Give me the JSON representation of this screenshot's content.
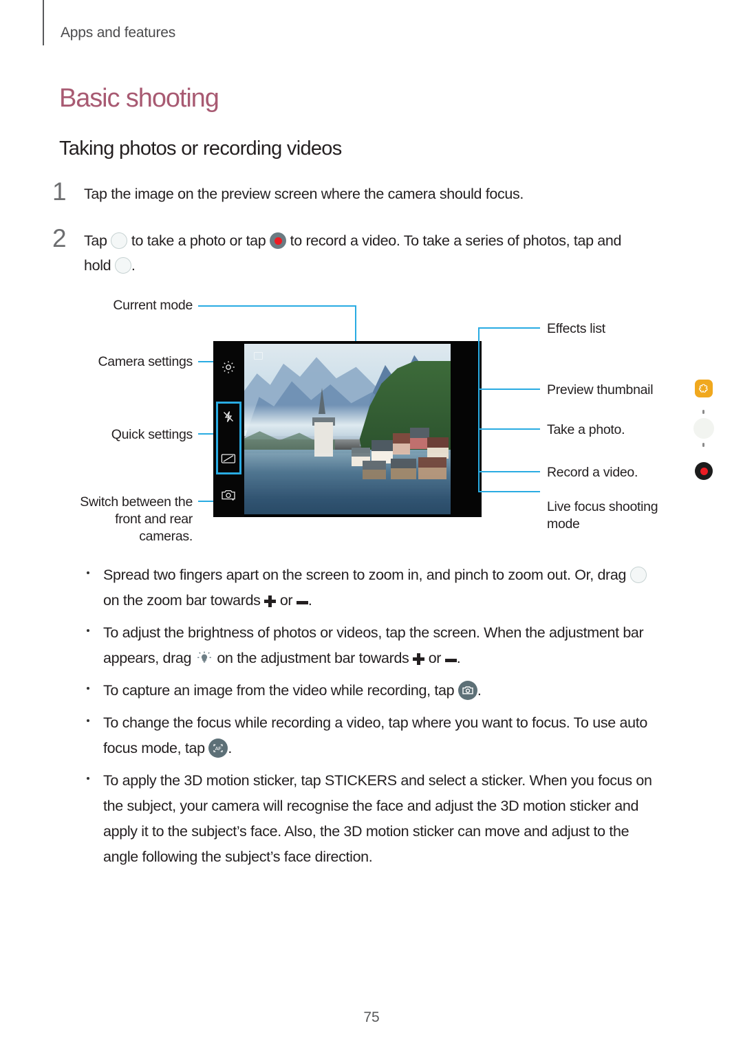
{
  "header": {
    "running_head": "Apps and features"
  },
  "chapter_title": "Basic shooting",
  "section_title": "Taking photos or recording videos",
  "steps": [
    {
      "num": "1",
      "text_before": "Tap the image on the preview screen where the camera should focus.",
      "text_mid": "",
      "text_after": ""
    },
    {
      "num": "2",
      "part1": "Tap",
      "part2": "to take a photo or tap",
      "part3": "to record a video. To take a series of photos, tap and",
      "part4": "hold",
      "part5": "."
    }
  ],
  "figure": {
    "labels_left": [
      {
        "id": "current-mode",
        "text": "Current mode"
      },
      {
        "id": "camera-settings",
        "text": "Camera settings"
      },
      {
        "id": "quick-settings",
        "text": "Quick settings"
      },
      {
        "id": "switch-cameras",
        "line1": "Switch between the",
        "line2": "front and rear",
        "line3": "cameras."
      }
    ],
    "labels_right": [
      {
        "id": "effects-list",
        "text": "Effects list"
      },
      {
        "id": "preview-thumbnail",
        "text": "Preview thumbnail"
      },
      {
        "id": "take-a-photo",
        "text": "Take a photo."
      },
      {
        "id": "record-a-video",
        "text": "Record a video."
      },
      {
        "id": "live-focus",
        "line1": "Live focus shooting",
        "line2": "mode"
      }
    ],
    "accent_color": "#29abe2",
    "thumbnail_color": "#f0a81e",
    "record_color": "#ec1c24"
  },
  "bullets": [
    {
      "id": "zoom-bullet",
      "p1": "Spread two fingers apart on the screen to zoom in, and pinch to zoom out. Or, drag",
      "p2": "on the zoom bar towards",
      "p3": "or",
      "p4": "."
    },
    {
      "id": "brightness-bullet",
      "p1": "To adjust the brightness of photos or videos, tap the screen. When the adjustment bar",
      "p2": "appears, drag",
      "p3": "on the adjustment bar towards",
      "p4": "or",
      "p5": "."
    },
    {
      "id": "capture-bullet",
      "p1": "To capture an image from the video while recording, tap",
      "p2": "."
    },
    {
      "id": "focus-bullet",
      "p1": "To change the focus while recording a video, tap where you want to focus. To use auto",
      "p2": "focus mode, tap",
      "p3": "."
    },
    {
      "id": "sticker-bullet",
      "p1": "To apply the 3D motion sticker, tap STICKERS and select a sticker. When you focus on",
      "p2": "the subject, your camera will recognise the face and adjust the 3D motion sticker and",
      "p3": "apply it to the subject’s face. Also, the 3D motion sticker can move and adjust to the",
      "p4": "angle following the subject’s face direction."
    }
  ],
  "footer": {
    "page_number": "75"
  }
}
